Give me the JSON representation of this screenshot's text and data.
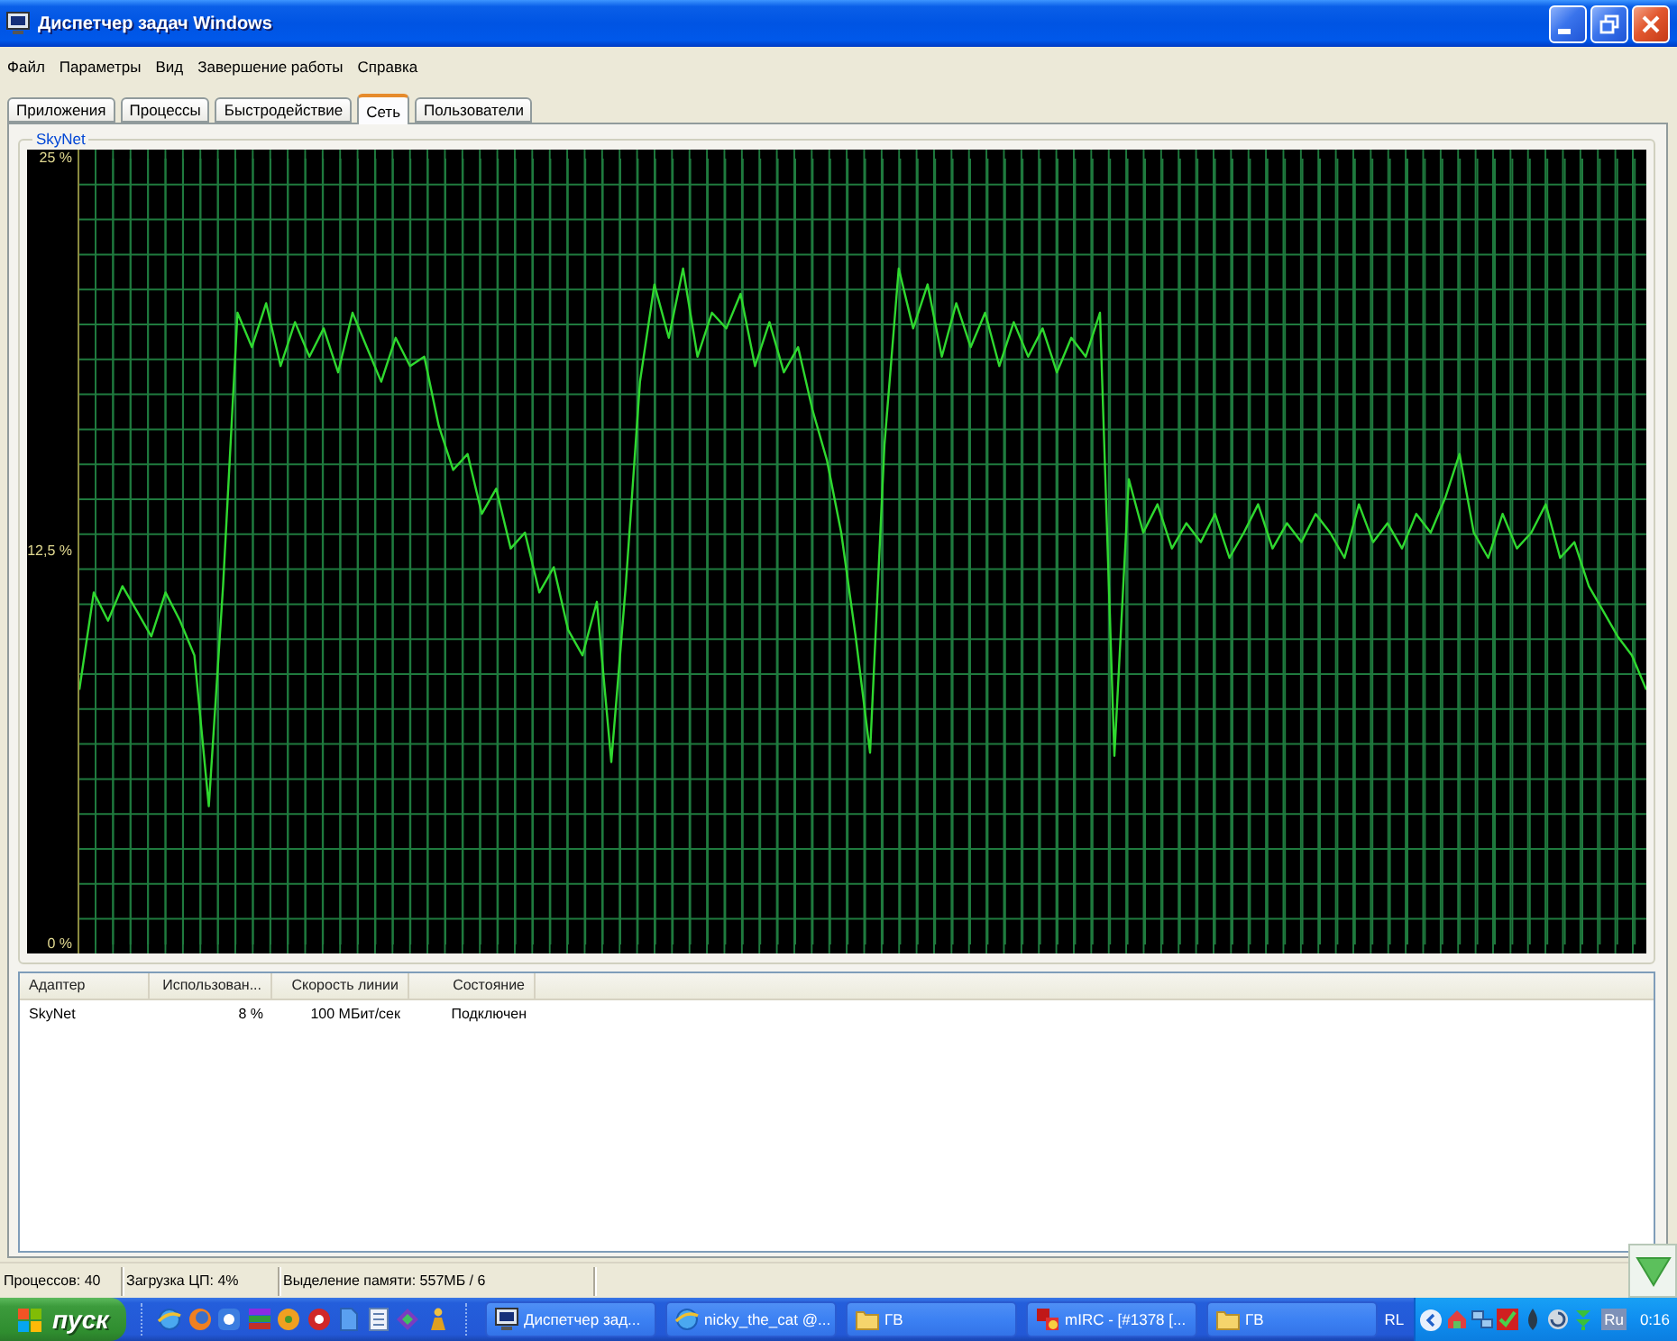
{
  "window": {
    "title": "Диспетчер задач Windows"
  },
  "menu": [
    "Файл",
    "Параметры",
    "Вид",
    "Завершение работы",
    "Справка"
  ],
  "tabs": [
    {
      "label": "Приложения",
      "selected": false
    },
    {
      "label": "Процессы",
      "selected": false
    },
    {
      "label": "Быстродействие",
      "selected": false
    },
    {
      "label": "Сеть",
      "selected": true
    },
    {
      "label": "Пользователи",
      "selected": false
    }
  ],
  "network_graph": {
    "chart_data": {
      "type": "line",
      "title": "SkyNet",
      "grid": true,
      "ylim": [
        0,
        25
      ],
      "yticks": [
        {
          "value": 25,
          "label": "25 %"
        },
        {
          "value": 12.5,
          "label": "12,5 %"
        },
        {
          "value": 0,
          "label": "0 %"
        }
      ],
      "values": [
        8.1,
        11.2,
        10.3,
        11.4,
        10.6,
        9.8,
        11.2,
        10.3,
        9.2,
        4.4,
        11.4,
        20.1,
        19.0,
        20.4,
        18.4,
        19.8,
        18.7,
        19.6,
        18.2,
        20.1,
        19.0,
        17.9,
        19.3,
        18.4,
        18.7,
        16.5,
        15.1,
        15.6,
        13.7,
        14.5,
        12.6,
        13.1,
        11.2,
        12.0,
        10.0,
        9.2,
        10.9,
        5.8,
        11.4,
        17.9,
        21.0,
        19.3,
        21.5,
        18.7,
        20.1,
        19.6,
        20.7,
        18.4,
        19.8,
        18.2,
        19.0,
        17.0,
        15.4,
        13.1,
        9.8,
        6.1,
        15.9,
        21.5,
        19.6,
        21.0,
        18.7,
        20.4,
        19.0,
        20.1,
        18.4,
        19.8,
        18.7,
        19.6,
        18.2,
        19.3,
        18.7,
        20.1,
        6.0,
        14.8,
        13.1,
        14.0,
        12.6,
        13.4,
        12.8,
        13.7,
        12.3,
        13.1,
        14.0,
        12.6,
        13.4,
        12.8,
        13.7,
        13.1,
        12.3,
        14.0,
        12.8,
        13.4,
        12.6,
        13.7,
        13.1,
        14.2,
        15.6,
        13.1,
        12.3,
        13.7,
        12.6,
        13.1,
        14.0,
        12.3,
        12.8,
        11.4,
        10.6,
        9.8,
        9.2,
        8.1
      ]
    }
  },
  "adapters_table": {
    "columns": [
      "Адаптер",
      "Использован...",
      "Скорость линии",
      "Состояние"
    ],
    "rows": [
      [
        "SkyNet",
        "8 %",
        "100 МБит/сек",
        "Подключен"
      ]
    ]
  },
  "status_bar": [
    "Процессов: 40",
    "Загрузка ЦП: 4%",
    "Выделение памяти: 557МБ / 6"
  ],
  "taskbar": {
    "start": "пуск",
    "tasks": [
      {
        "kind": "app",
        "label": "Диспетчер зад..."
      },
      {
        "kind": "browser",
        "label": "nicky_the_cat @..."
      },
      {
        "kind": "folder",
        "label": "ГВ"
      },
      {
        "kind": "chat",
        "label": "mIRC - [#1378 [..."
      },
      {
        "kind": "folder",
        "label": "ГВ"
      }
    ],
    "tray": {
      "indicator": "RL",
      "language": "Ru",
      "clock": "0:16"
    }
  }
}
